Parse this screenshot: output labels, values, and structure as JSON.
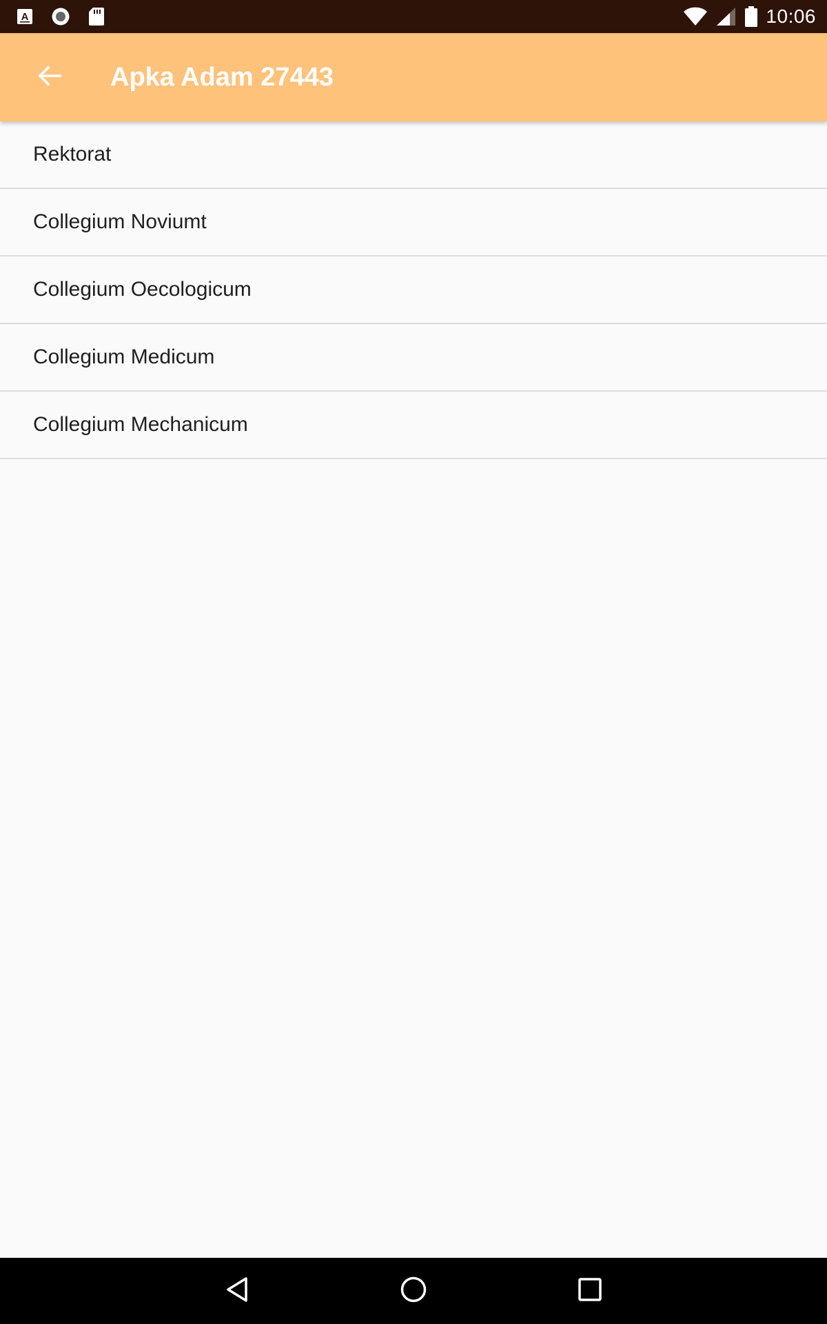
{
  "status_bar": {
    "time": "10:06",
    "left_icons": [
      "text-a-icon",
      "record-icon",
      "sd-card-icon"
    ],
    "right_icons": [
      "wifi-icon",
      "signal-icon",
      "battery-icon"
    ]
  },
  "app_bar": {
    "title": "Apka Adam 27443",
    "background_color": "#ffc27b",
    "back_icon": "arrow-back-icon"
  },
  "list": {
    "items": [
      {
        "label": "Rektorat"
      },
      {
        "label": "Collegium Noviumt"
      },
      {
        "label": "Collegium Oecologicum"
      },
      {
        "label": "Collegium Medicum"
      },
      {
        "label": "Collegium Mechanicum"
      }
    ]
  },
  "nav_bar": {
    "icons": [
      "nav-back-icon",
      "nav-home-icon",
      "nav-recents-icon"
    ]
  }
}
